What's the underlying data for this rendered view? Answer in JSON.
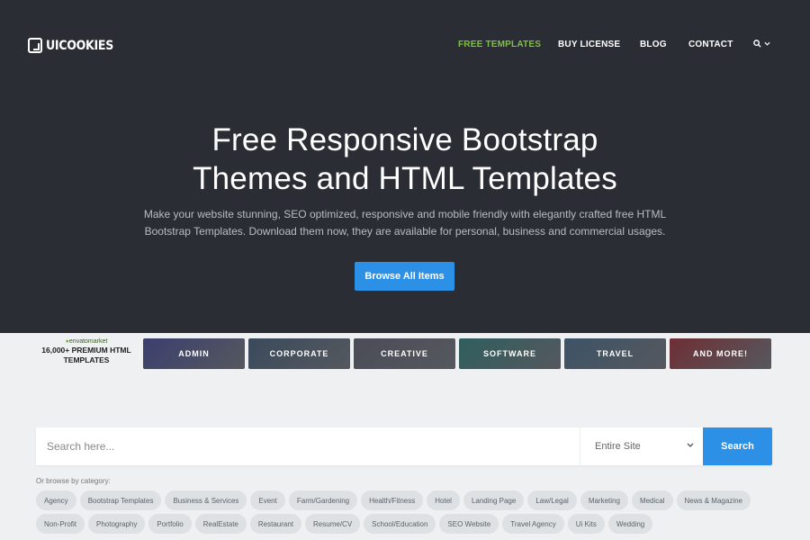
{
  "header": {
    "logo_text": "UICOOKIES",
    "nav": [
      {
        "label": "FREE TEMPLATES",
        "active": true
      },
      {
        "label": "BUY LICENSE",
        "active": false
      },
      {
        "label": "BLOG",
        "active": false
      },
      {
        "label": "CONTACT",
        "active": false
      }
    ],
    "search_icon": "search-icon",
    "chevron_icon": "chevron-down-icon"
  },
  "hero": {
    "title_line1": "Free Responsive Bootstrap",
    "title_line2": "Themes and HTML Templates",
    "subtitle_line1": "Make your website stunning, SEO optimized, responsive and mobile friendly with elegantly crafted free HTML",
    "subtitle_line2": "Bootstrap Templates. Download them now, they are available for personal, business and commercial usages.",
    "button_label": "Browse All Items"
  },
  "envato": {
    "brand": "envatomarket",
    "line1": "16,000+ PREMIUM HTML",
    "line2": "TEMPLATES"
  },
  "categories": [
    {
      "label": "ADMIN",
      "color": "#3b3f6e"
    },
    {
      "label": "CORPORATE",
      "color": "#3a4a5c"
    },
    {
      "label": "CREATIVE",
      "color": "#4a4d57"
    },
    {
      "label": "SOFTWARE",
      "color": "#2f5e5e"
    },
    {
      "label": "TRAVEL",
      "color": "#3d5366"
    },
    {
      "label": "AND MORE!",
      "color": "#6e2f34"
    }
  ],
  "search": {
    "placeholder": "Search here...",
    "scope": "Entire Site",
    "button_label": "Search"
  },
  "browse": {
    "label": "Or browse by category:",
    "tags": [
      "Agency",
      "Bootstrap Templates",
      "Business & Services",
      "Event",
      "Farm/Gardening",
      "Health/Fitness",
      "Hotel",
      "Landing Page",
      "Law/Legal",
      "Marketing",
      "Medical",
      "News & Magazine",
      "Non-Profit",
      "Photography",
      "Portfolio",
      "RealEstate",
      "Restaurant",
      "Resume/CV",
      "School/Education",
      "SEO Website",
      "Travel Agency",
      "Ui Kits",
      "Wedding"
    ]
  },
  "colors": {
    "hero_bg": "#2a2d33",
    "accent": "#2b90e6",
    "nav_active": "#7fc143",
    "page_bg": "#eef0f1"
  }
}
